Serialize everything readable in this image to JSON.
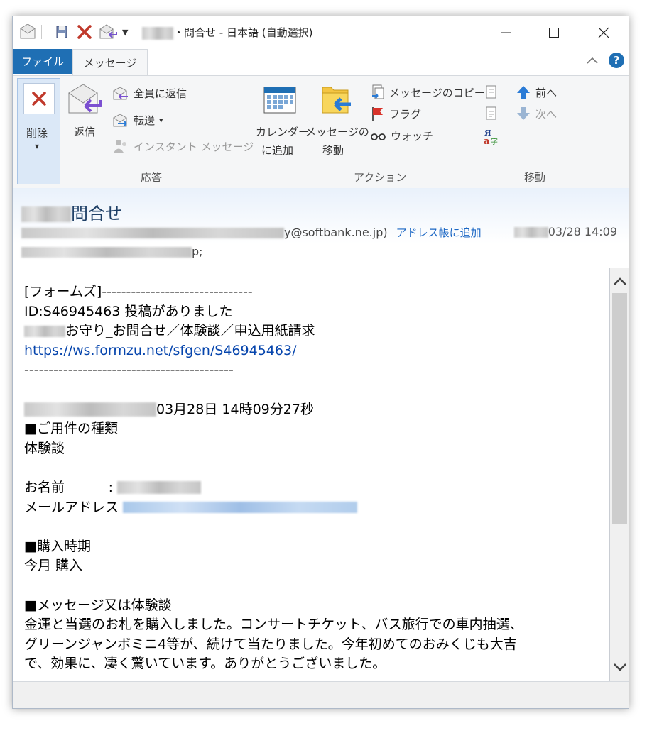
{
  "window": {
    "title": "・問合せ - 日本語 (自動選択)"
  },
  "tabs": {
    "file": "ファイル",
    "message": "メッセージ"
  },
  "ribbon": {
    "delete": {
      "line1": "削除",
      "arrow": "▾"
    },
    "reply": "返信",
    "reply_all": "全員に返信",
    "forward": "転送",
    "forward_arrow": "▾",
    "instant": "インスタント メッセージ",
    "group_respond": "応答",
    "calendar_line1": "カレンダー",
    "calendar_line2": "に追加",
    "move_line1": "メッセージの",
    "move_line2": "移動",
    "copy": "メッセージのコピー",
    "flag": "フラグ",
    "watch": "ウォッチ",
    "group_action": "アクション",
    "prev": "前へ",
    "next": "次へ",
    "group_move": "移動"
  },
  "header": {
    "subject": "問合せ",
    "from_visible": "y@softbank.ne.jp)",
    "add_contact": "アドレス帳に追加",
    "date": "03/28 14:09",
    "to_suffix": "p;"
  },
  "body": {
    "line1": "[フォームズ]-------------------------------",
    "line2": "ID:S46945463 投稿がありました",
    "line3": "お守り_お問合せ／体験談／申込用紙請求",
    "link": "https://ws.formzu.net/sfgen/S46945463/",
    "rule": "-------------------------------------------",
    "timestamp": "03月28日 14時09分27秒",
    "kind_heading": "■ご用件の種類",
    "kind_value": "体験談",
    "name_label": "お名前",
    "name_sep": ":",
    "mail_label": "メールアドレス",
    "purchase_heading": "■購入時期",
    "purchase_value": "今月 購入",
    "message_heading": "■メッセージ又は体験談",
    "message_1": "金運と当選のお札を購入しました。コンサートチケット、バス旅行での車内抽選、",
    "message_2": "グリーンジャンボミニ4等が、続けて当たりました。今年初めてのおみくじも大吉",
    "message_3": "で、効果に、凄く驚いています。ありがとうございました。"
  },
  "colors": {
    "file_tab": "#1f6fb4",
    "link": "#0645ad",
    "subject": "#1e3f66",
    "delete_red": "#c0392b"
  }
}
